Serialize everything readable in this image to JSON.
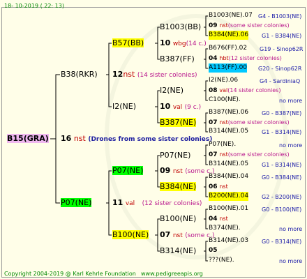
{
  "header": {
    "date": "18- 10-2019 ( 22: 13)"
  },
  "footer": {
    "copyright": "Copyright 2004-2019 @ Karl Kehrle Foundation",
    "site": "www.pedigreeapis.org"
  },
  "root": {
    "name": "B15(GRA)",
    "num": "16",
    "nst": "nst",
    "note": "(Drones from some sister colonies)"
  },
  "queen_side": {
    "b38": {
      "name": "B38(RKR)",
      "num": "12",
      "nst": "nst",
      "note": "(14 sister colonies)"
    },
    "b57": {
      "name": "B57(BB)"
    },
    "i2ne_mid": {
      "name": "I2(NE)",
      "num": "10",
      "val": "val",
      "note": "(9 c.)"
    },
    "b1003": {
      "name": "B1003(BB)",
      "num": "10",
      "tag": "wbg",
      "note": "(14 c.)"
    },
    "b387ff": {
      "name": "B387(FF)",
      "num": "04",
      "tag": "hbt",
      "note": "(12 sister colonies)"
    },
    "i2ne": {
      "name": "I2(NE)",
      "num": "08",
      "val": "val",
      "note": "(14 sister colonies)"
    },
    "b387ne": {
      "name": "B387(NE)",
      "num": "07",
      "nst": "nst",
      "note": "(some sister colonies)"
    }
  },
  "drone_side": {
    "p07": {
      "name": "P07(NE)",
      "num": "11",
      "val": "val",
      "note": "(12 sister colonies)"
    },
    "p07b": {
      "name": "P07(NE)",
      "num": "09",
      "nst": "nst",
      "note": "(some c.)"
    },
    "b100": {
      "name": "B100(NE)",
      "num": "07",
      "nst": "nst",
      "note": "(some c.)"
    },
    "p07c": {
      "name": "P07(NE)",
      "num": "07",
      "nst": "nst",
      "note": "(some sister colonies)"
    },
    "b384": {
      "name": "B384(NE)",
      "num": "06",
      "nst": "nst"
    },
    "b100ne": {
      "name": "B100(NE)",
      "num": "04",
      "nst": "nst"
    },
    "b314": {
      "name": "B314(NE)",
      "num": "05"
    }
  },
  "right_col": [
    {
      "name": "B1003(NE).07",
      "code": "G4 - B1003(NE)"
    },
    {
      "name": "B384(NE).06",
      "code": "G1 - B384(NE)"
    },
    {
      "name": "B676(FF).02",
      "code": "G19 - Sinop62R"
    },
    {
      "name": "A113(FF).00",
      "code": "G20 - Sinop62R"
    },
    {
      "name": "I2(NE).06",
      "code": "G4 - SardiniaQ"
    },
    {
      "name": "C100(NE).",
      "code": "no more"
    },
    {
      "name": "B387(NE).06",
      "code": "G0 - B387(NE)"
    },
    {
      "name": "B314(NE).05",
      "code": "G1 - B314(NE)"
    },
    {
      "name": "P07(NE).",
      "code": "no more"
    },
    {
      "name": "B314(NE).05",
      "code": "G1 - B314(NE)"
    },
    {
      "name": "B384(NE).04",
      "code": "G0 - B384(NE)"
    },
    {
      "name": "B200(NE).04",
      "code": "G2 - B200(NE)"
    },
    {
      "name": "B100(NE).01",
      "code": "G0 - B100(NE)"
    },
    {
      "name": "B374(NE).",
      "code": "no more"
    },
    {
      "name": "B314(NE).03",
      "code": "G0 - B314(NE)"
    },
    {
      "name": "???(NE).",
      "code": "no more"
    }
  ],
  "right_num": [
    {
      "num": "09",
      "tag": "nst",
      "note": "(some sister colonies)"
    }
  ]
}
